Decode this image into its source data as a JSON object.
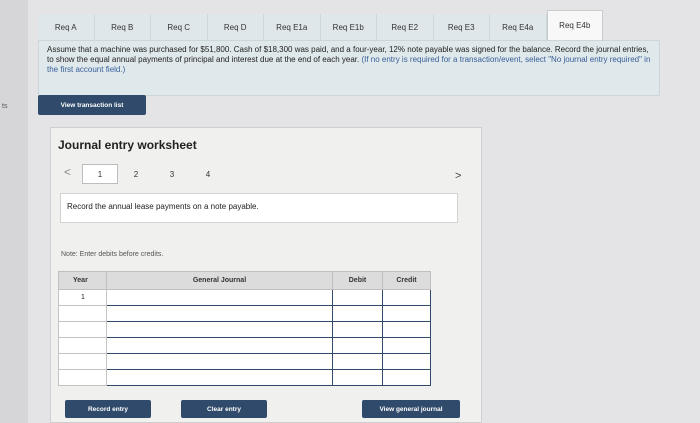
{
  "side": {
    "edge_label": "ts"
  },
  "tabs": [
    {
      "label": "Req A"
    },
    {
      "label": "Req B"
    },
    {
      "label": "Req C"
    },
    {
      "label": "Req D"
    },
    {
      "label": "Req E1a"
    },
    {
      "label": "Req E1b"
    },
    {
      "label": "Req E2"
    },
    {
      "label": "Req E3"
    },
    {
      "label": "Req E4a"
    },
    {
      "label": "Req E4b"
    }
  ],
  "active_tab": "Req E4b",
  "question": {
    "text": "Assume that a machine was purchased for $51,800. Cash of $18,300 was paid, and a four-year, 12% note payable was signed for the balance. Record the journal entries, to show the equal annual payments of principal and interest due at the end of each year.",
    "emphasis": "(If no entry is required for a transaction/event, select \"No journal entry required\" in the first account field.)"
  },
  "buttons": {
    "view_transaction_list": "View transaction list",
    "record_entry": "Record entry",
    "clear_entry": "Clear entry",
    "view_general_journal": "View general journal"
  },
  "worksheet": {
    "title": "Journal entry worksheet",
    "nav_prev": "<",
    "nav_next": ">",
    "steps": [
      "1",
      "2",
      "3",
      "4"
    ],
    "active_step": "1",
    "instruction": "Record the annual lease payments on a note payable.",
    "note": "Note: Enter debits before credits.",
    "table": {
      "headers": {
        "year": "Year",
        "general_journal": "General Journal",
        "debit": "Debit",
        "credit": "Credit"
      },
      "rows": [
        {
          "year": "1"
        },
        {
          "year": ""
        },
        {
          "year": ""
        },
        {
          "year": ""
        },
        {
          "year": ""
        },
        {
          "year": ""
        }
      ]
    }
  }
}
